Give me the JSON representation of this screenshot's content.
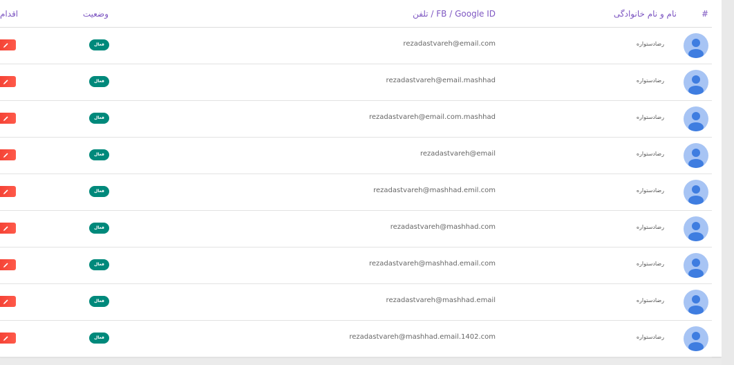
{
  "table": {
    "headers": {
      "hash": "#",
      "name": "نام و نام خانوادگی",
      "contact": "تلفن / FB / Google ID",
      "status": "وضعیت",
      "action": "اقدام"
    },
    "rows": [
      {
        "name": "رضادستواره",
        "contact": "rezadastvareh@email.com",
        "status": "فعال"
      },
      {
        "name": "رضادستواره",
        "contact": "rezadastvareh@email.mashhad",
        "status": "فعال"
      },
      {
        "name": "رضادستواره",
        "contact": "rezadastvareh@email.com.mashhad",
        "status": "فعال"
      },
      {
        "name": "رضادستواره",
        "contact": "rezadastvareh@email",
        "status": "فعال"
      },
      {
        "name": "رضادستواره",
        "contact": "rezadastvareh@mashhad.emil.com",
        "status": "فعال"
      },
      {
        "name": "رضادستواره",
        "contact": "rezadastvareh@mashhad.com",
        "status": "فعال"
      },
      {
        "name": "رضادستواره",
        "contact": "rezadastvareh@mashhad.email.com",
        "status": "فعال"
      },
      {
        "name": "رضادستواره",
        "contact": "rezadastvareh@mashhad.email",
        "status": "فعال"
      },
      {
        "name": "رضادستواره",
        "contact": "rezadastvareh@mashhad.email.1402.com",
        "status": "فعال"
      }
    ]
  },
  "colors": {
    "header_text": "#7e57c2",
    "status_badge": "#00897b",
    "edit_button": "#f44336",
    "avatar_bg": "#a7c4f4",
    "avatar_fg": "#3f7de0"
  },
  "icons": {
    "avatar": "user-avatar-icon",
    "edit": "pencil-icon"
  }
}
